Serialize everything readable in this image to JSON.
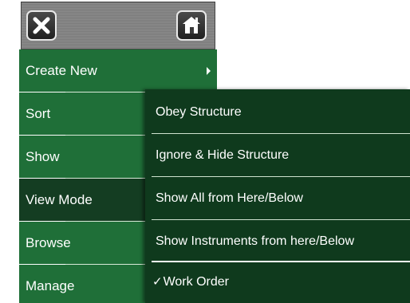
{
  "header": {
    "close_icon": "close-x-icon",
    "home_icon": "home-icon"
  },
  "menu": {
    "items": [
      {
        "label": "Create New",
        "has_submenu": true
      },
      {
        "label": "Sort"
      },
      {
        "label": "Show"
      },
      {
        "label": "View Mode",
        "selected": true
      },
      {
        "label": "Browse"
      },
      {
        "label": "Manage"
      }
    ]
  },
  "submenu": {
    "items": [
      {
        "label": "Obey Structure"
      },
      {
        "label": "Ignore & Hide Structure"
      },
      {
        "label": "Show All from Here/Below"
      },
      {
        "label": "Show Instruments from here/Below"
      },
      {
        "label": "Work Order",
        "checked": true,
        "check_mark": "✓"
      }
    ]
  },
  "colors": {
    "menu_green": "#1f6f38",
    "menu_selected": "#143d22",
    "submenu_bg": "#0f3a1d",
    "text": "#ffffff"
  }
}
